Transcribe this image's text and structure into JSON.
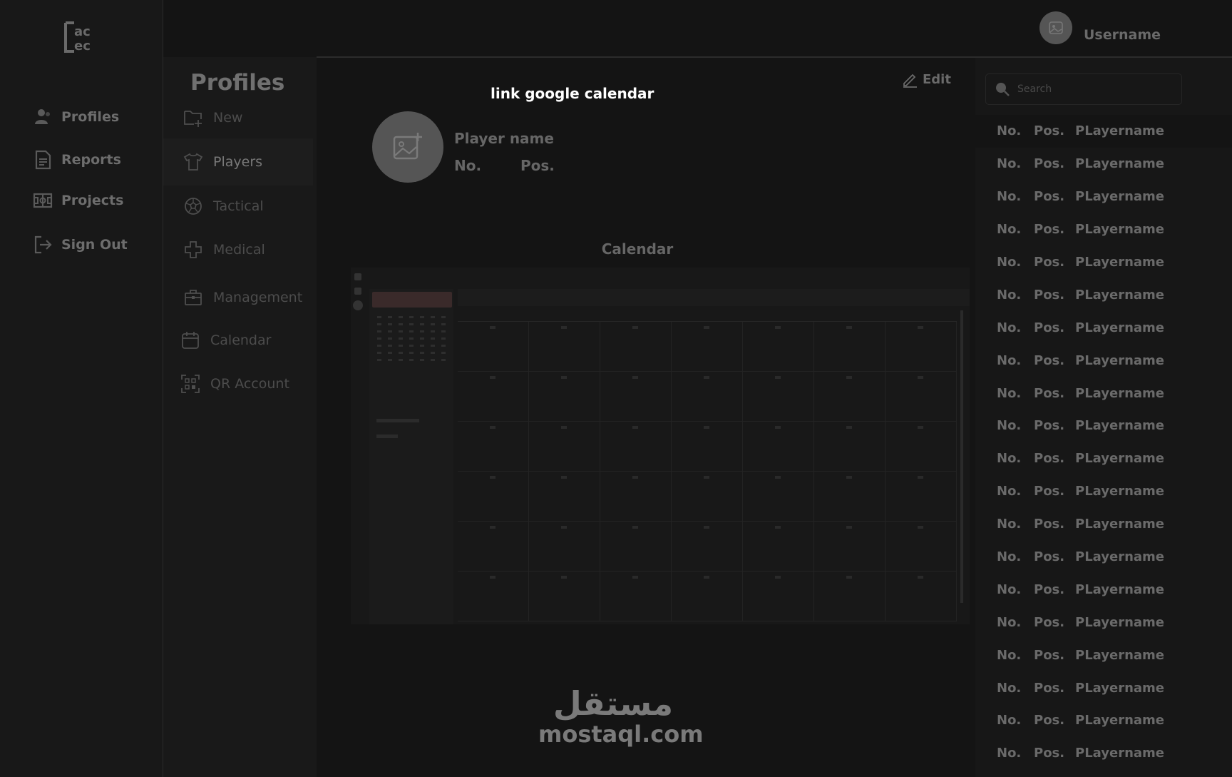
{
  "brand": {
    "logo_letters": [
      "ac",
      "ec"
    ]
  },
  "left_nav": {
    "items": [
      {
        "label": "Profiles",
        "icon": "user-icon"
      },
      {
        "label": "Reports",
        "icon": "document-icon"
      },
      {
        "label": "Projects",
        "icon": "field-icon"
      },
      {
        "label": "Sign Out",
        "icon": "sign-out-icon"
      }
    ]
  },
  "submenu": {
    "title": "Profiles",
    "items": [
      {
        "label": "New",
        "icon": "new-folder-icon"
      },
      {
        "label": "Players",
        "icon": "shirt-icon",
        "active": true
      },
      {
        "label": "Tactical",
        "icon": "ball-icon"
      },
      {
        "label": "Medical",
        "icon": "medical-cross-icon"
      },
      {
        "label": "Management",
        "icon": "briefcase-icon"
      },
      {
        "label": "Calendar",
        "icon": "calendar-icon"
      },
      {
        "label": "QR Account",
        "icon": "qr-icon"
      }
    ]
  },
  "header": {
    "username": "Username"
  },
  "main": {
    "link_google_calendar": "link google calendar",
    "edit_label": "Edit",
    "player": {
      "name": "Player name",
      "no_label": "No.",
      "pos_label": "Pos."
    },
    "calendar_title": "Calendar"
  },
  "watermark": {
    "arabic": "مستقل",
    "latin": "mostaql.com"
  },
  "right_panel": {
    "search_placeholder": "Search",
    "roster": [
      {
        "no": "No.",
        "pos": "Pos.",
        "name": "PLayername"
      },
      {
        "no": "No.",
        "pos": "Pos.",
        "name": "PLayername"
      },
      {
        "no": "No.",
        "pos": "Pos.",
        "name": "PLayername"
      },
      {
        "no": "No.",
        "pos": "Pos.",
        "name": "PLayername"
      },
      {
        "no": "No.",
        "pos": "Pos.",
        "name": "PLayername"
      },
      {
        "no": "No.",
        "pos": "Pos.",
        "name": "PLayername"
      },
      {
        "no": "No.",
        "pos": "Pos.",
        "name": "PLayername"
      },
      {
        "no": "No.",
        "pos": "Pos.",
        "name": "PLayername"
      },
      {
        "no": "No.",
        "pos": "Pos.",
        "name": "PLayername"
      },
      {
        "no": "No.",
        "pos": "Pos.",
        "name": "PLayername"
      },
      {
        "no": "No.",
        "pos": "Pos.",
        "name": "PLayername"
      },
      {
        "no": "No.",
        "pos": "Pos.",
        "name": "PLayername"
      },
      {
        "no": "No.",
        "pos": "Pos.",
        "name": "PLayername"
      },
      {
        "no": "No.",
        "pos": "Pos.",
        "name": "PLayername"
      },
      {
        "no": "No.",
        "pos": "Pos.",
        "name": "PLayername"
      },
      {
        "no": "No.",
        "pos": "Pos.",
        "name": "PLayername"
      },
      {
        "no": "No.",
        "pos": "Pos.",
        "name": "PLayername"
      },
      {
        "no": "No.",
        "pos": "Pos.",
        "name": "PLayername"
      },
      {
        "no": "No.",
        "pos": "Pos.",
        "name": "PLayername"
      },
      {
        "no": "No.",
        "pos": "Pos.",
        "name": "PLayername"
      }
    ]
  },
  "colors": {
    "background": "#141414",
    "sidebar": "#181818",
    "text_muted": "#6a6a6a",
    "highlight": "#ffffff"
  }
}
